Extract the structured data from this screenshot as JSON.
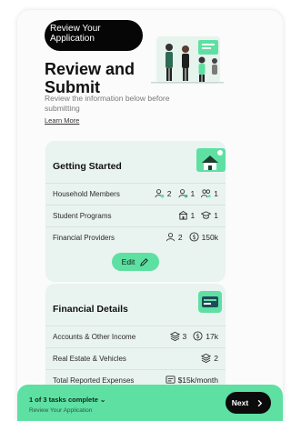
{
  "header": {
    "pill_text": "Review Your Application",
    "title": "Review and Submit",
    "subtitle": "Review the information below before submitting",
    "learn_more": "Learn More"
  },
  "getting_started": {
    "title": "Getting Started",
    "rows": [
      {
        "label": "Household Members",
        "values": [
          "2",
          "1",
          "1"
        ]
      },
      {
        "label": "Student Programs",
        "values": [
          "1",
          "1"
        ]
      },
      {
        "label": "Financial Providers",
        "values": [
          "2",
          "150k"
        ]
      }
    ],
    "edit_label": "Edit"
  },
  "financial_details": {
    "title": "Financial Details",
    "rows": [
      {
        "label": "Accounts & Other Income",
        "values": [
          "3",
          "17k"
        ]
      },
      {
        "label": "Real Estate & Vehicles",
        "values": [
          "2"
        ]
      },
      {
        "label": "Total Reported Expenses",
        "values": [
          "$15k/month"
        ]
      }
    ]
  },
  "footer": {
    "progress": "1 of 3 tasks complete",
    "progress_sub": "Review Your Application",
    "next_label": "Next"
  },
  "colors": {
    "accent": "#5ee0a3",
    "card_bg": "#e9f3f0",
    "dark": "#060606"
  }
}
